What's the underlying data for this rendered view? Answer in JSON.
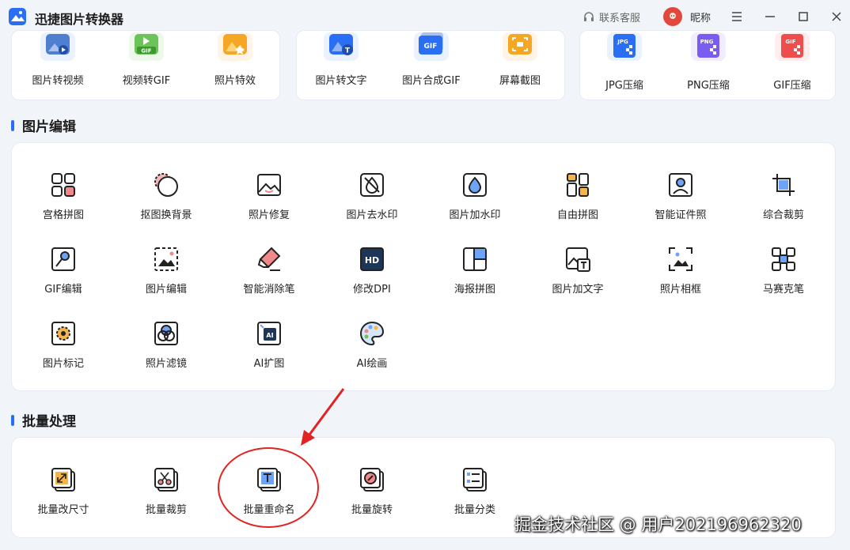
{
  "app": {
    "title": "迅捷图片转换器",
    "support_label": "联系客服",
    "nickname": "昵称",
    "accent_color": "#2a6ff3"
  },
  "top_tools": {
    "group1": [
      {
        "label": "图片转视频",
        "icon": "image-to-video-icon"
      },
      {
        "label": "视频转GIF",
        "icon": "video-to-gif-icon"
      },
      {
        "label": "照片特效",
        "icon": "photo-effects-icon"
      }
    ],
    "group2": [
      {
        "label": "图片转文字",
        "icon": "image-to-text-icon"
      },
      {
        "label": "图片合成GIF",
        "icon": "image-to-gif-icon"
      },
      {
        "label": "屏幕截图",
        "icon": "screenshot-icon"
      }
    ],
    "group3": [
      {
        "label": "JPG压缩",
        "icon": "jpg-compress-icon"
      },
      {
        "label": "PNG压缩",
        "icon": "png-compress-icon"
      },
      {
        "label": "GIF压缩",
        "icon": "gif-compress-icon"
      }
    ],
    "icon_badges": {
      "gif": "GIF",
      "text": "T",
      "jpg": "JPG",
      "png": "PNG"
    }
  },
  "image_edit": {
    "title": "图片编辑",
    "tools": [
      "宫格拼图",
      "抠图换背景",
      "照片修复",
      "图片去水印",
      "图片加水印",
      "自由拼图",
      "智能证件照",
      "综合裁剪",
      "GIF编辑",
      "图片编辑",
      "智能消除笔",
      "修改DPI",
      "海报拼图",
      "图片加文字",
      "照片相框",
      "马赛克笔",
      "图片标记",
      "照片滤镜",
      "AI扩图",
      "AI绘画"
    ],
    "icon_text": {
      "hd": "HD",
      "ai": "AI"
    }
  },
  "batch": {
    "title": "批量处理",
    "tools": [
      "批量改尺寸",
      "批量裁剪",
      "批量重命名",
      "批量旋转",
      "批量分类"
    ],
    "highlighted": "批量重命名"
  },
  "watermark": "掘金技术社区 @ 用户2021969623​20"
}
